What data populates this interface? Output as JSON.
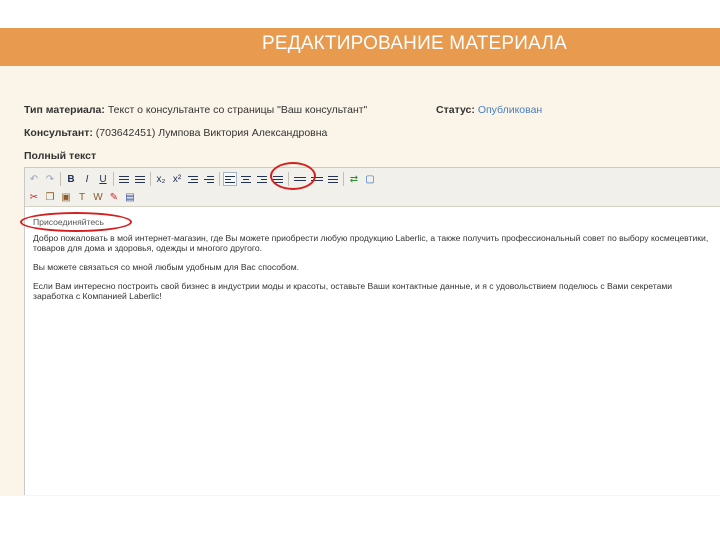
{
  "page": {
    "title": "РЕДАКТИРОВАНИЕ МАТЕРИАЛА"
  },
  "material": {
    "type_label": "Тип материала:",
    "type_value": "Текст о консультанте со страницы \"Ваш консультант\"",
    "status_label": "Статус:",
    "status_value": "Опубликован",
    "consultant_label": "Консультант:",
    "consultant_value": "(703642451) Лумпова Виктория Александровна",
    "fulltext_label": "Полный текст"
  },
  "editor": {
    "toolbar_icons": [
      "undo-icon",
      "redo-icon",
      "bold-icon",
      "italic-icon",
      "underline-icon",
      "ordered-list-icon",
      "bulleted-list-icon",
      "subscript-icon",
      "superscript-icon",
      "indent-icon",
      "outdent-icon",
      "align-left-icon",
      "align-center-icon",
      "align-right-icon",
      "align-justify-icon",
      "rule-icon",
      "rule-alt-icon",
      "format-icon",
      "link-icon",
      "fullscreen-icon",
      "cut-icon",
      "copy-icon",
      "paste-icon",
      "paste-text-icon",
      "paste-word-icon",
      "clean-icon",
      "save-icon"
    ],
    "heading": "Присоединяйтесь",
    "paragraphs": [
      "Добро пожаловать в мой интернет-магазин, где Вы можете приобрести любую продукцию Laberlic, а также получить профессиональный совет по выбору космецевтики,",
      "товаров для дома и здоровья, одежды и многого другого.",
      "Вы можете связаться со мной любым удобным для Вас способом.",
      "Если Вам интересно построить свой бизнес в индустрии моды и красоты, оставьте Ваши контактные данные, и я с удовольствием поделюсь с Вами секретами",
      "заработка с Компанией Laberlic!"
    ]
  },
  "colors": {
    "banner": "#e89a4e",
    "panel": "#fbf5e9",
    "link": "#4a7fbf",
    "annotation": "#d42020"
  }
}
